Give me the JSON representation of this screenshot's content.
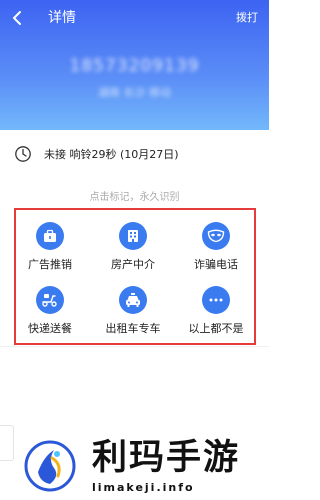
{
  "header": {
    "title": "详情",
    "dial_label": "拨打",
    "number": "18573209139",
    "location": "湖南 长沙 移动"
  },
  "call_record": {
    "icon": "clock-icon",
    "text": "未接 响铃29秒 (10月27日)"
  },
  "hint": "点击标记，永久识别",
  "tags": [
    {
      "label": "广告推销",
      "icon": "briefcase-icon"
    },
    {
      "label": "房产中介",
      "icon": "building-icon"
    },
    {
      "label": "诈骗电话",
      "icon": "mask-icon"
    },
    {
      "label": "快递送餐",
      "icon": "scooter-icon"
    },
    {
      "label": "出租车专车",
      "icon": "car-icon"
    },
    {
      "label": "以上都不是",
      "icon": "more-icon"
    }
  ],
  "watermark": {
    "title": "利玛手游",
    "url": "limakeji.info"
  },
  "colors": {
    "header_top": "#3d63f2",
    "header_bottom": "#73b8fb",
    "icon_bg": "#3a7cf0",
    "highlight_border": "#e53b3b"
  }
}
